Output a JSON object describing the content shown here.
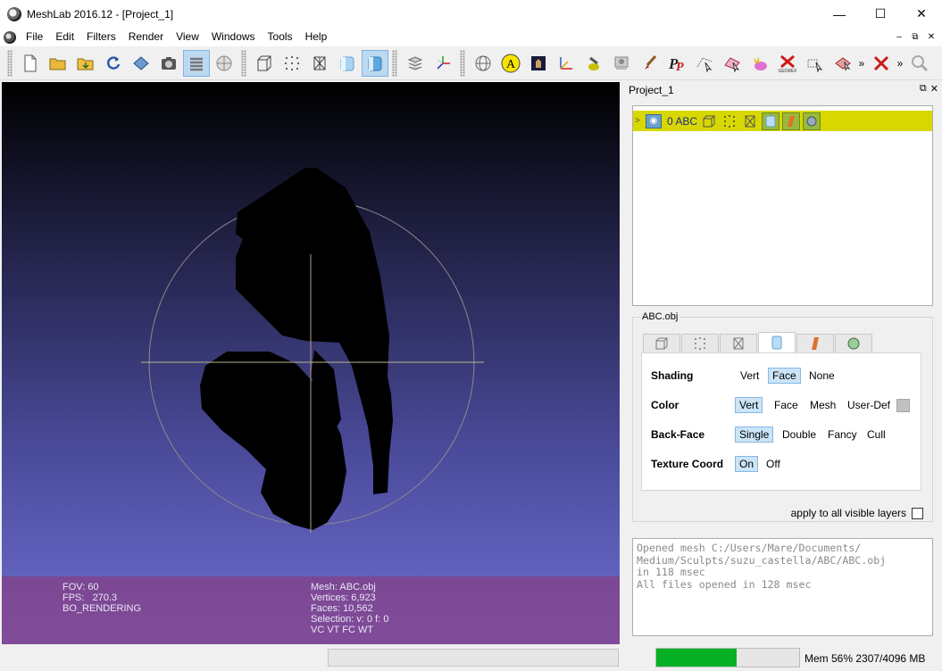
{
  "window": {
    "title": "MeshLab 2016.12 - [Project_1]",
    "controls": [
      "—",
      "☐",
      "✕"
    ]
  },
  "menu": {
    "items": [
      "File",
      "Edit",
      "Filters",
      "Render",
      "View",
      "Windows",
      "Tools",
      "Help"
    ],
    "mdi_controls": [
      "–",
      "⧉",
      "✕"
    ]
  },
  "toolbar": {
    "more": "»",
    "more2": "»"
  },
  "viewport": {
    "info_left": [
      "FOV: 60",
      "FPS:   270.3",
      "BO_RENDERING"
    ],
    "info_right": [
      "Mesh: ABC.obj",
      "Vertices: 6,923",
      "Faces: 10,562",
      "Selection: v: 0 f: 0",
      "VC VT FC WT"
    ]
  },
  "panel": {
    "title": "Project_1",
    "header_buttons": [
      "⧉",
      "✕"
    ],
    "layer": {
      "arrow": ">",
      "name": "0  ABC"
    }
  },
  "mesh": {
    "group_title": "ABC.obj",
    "options": {
      "shading": {
        "label": "Shading",
        "choices": [
          "Vert",
          "Face",
          "None"
        ],
        "selected": "Face"
      },
      "color": {
        "label": "Color",
        "choices": [
          "Vert",
          "Face",
          "Mesh",
          "User-Def"
        ],
        "selected": "Vert",
        "swatch": "#c0c0c0"
      },
      "backface": {
        "label": "Back-Face",
        "choices": [
          "Single",
          "Double",
          "Fancy",
          "Cull"
        ],
        "selected": "Single"
      },
      "texcoord": {
        "label": "Texture Coord",
        "choices": [
          "On",
          "Off"
        ],
        "selected": "On"
      }
    },
    "apply_all": "apply to all visible layers"
  },
  "log": {
    "lines": [
      "Opened mesh C:/Users/Mare/Documents/",
      "Medium/Sculpts/suzu_castella/ABC/ABC.obj",
      "in 118 msec",
      "All files opened in 128 msec"
    ]
  },
  "status": {
    "memory_text": "Mem 56% 2307/4096 MB",
    "memory_fraction": 0.56,
    "memory_color": "#06b025"
  }
}
